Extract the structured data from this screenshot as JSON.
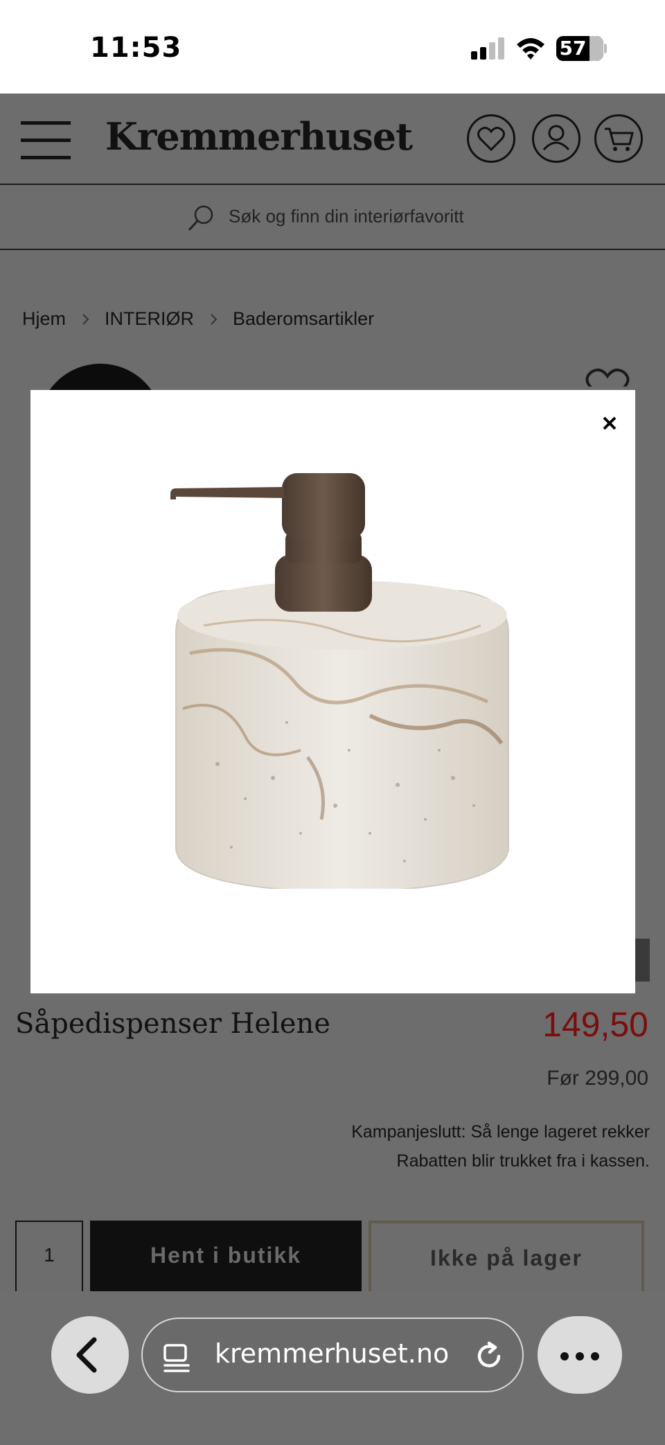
{
  "status_bar": {
    "time": "11:53",
    "battery": "57"
  },
  "header": {
    "logo": "Kremmerhuset",
    "icons": [
      "menu-icon",
      "heart-icon",
      "user-icon",
      "cart-icon"
    ]
  },
  "search": {
    "placeholder": "Søk og finn din interiørfavoritt"
  },
  "breadcrumb": {
    "items": [
      "Hjem",
      "INTERIØR",
      "Baderomsartikler"
    ]
  },
  "product": {
    "title": "Såpedispenser Helene",
    "price": "149,50",
    "old_price": "Før 299,00",
    "campaign_line": "Kampanjeslutt: Så lenge lageret rekker",
    "discount_note": "Rabatten blir trukket fra i kassen.",
    "quantity": "1",
    "pickup_label": "Hent i butikk",
    "stock_label": "Ikke på lager"
  },
  "modal": {
    "close_icon": "close-icon",
    "image_subject": "soap dispenser"
  },
  "browser": {
    "url": "kremmerhuset.no",
    "icons": [
      "back-icon",
      "tab-icon",
      "reload-icon",
      "more-icon"
    ]
  },
  "colors": {
    "overlay": "#6d6d6d",
    "price": "#7a0d0d",
    "modal_bg": "#ffffff"
  }
}
